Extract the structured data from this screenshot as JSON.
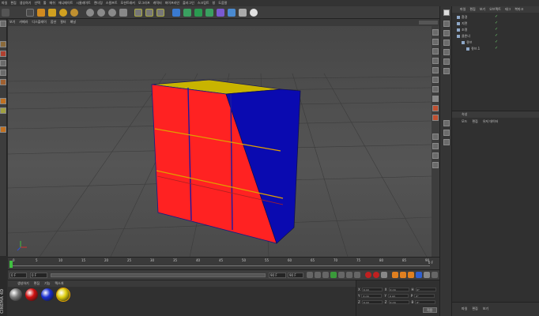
{
  "menubar": {
    "items": [
      "파일",
      "편집",
      "생성하기",
      "선택",
      "툴",
      "메쉬",
      "애니메이트",
      "시뮬레이트",
      "렌더링",
      "스컬프트",
      "모션트래커",
      "모그라프",
      "캐릭터",
      "파이프라인",
      "플러그인",
      "스크립트",
      "창",
      "도움말"
    ]
  },
  "viewport": {
    "menu": [
      "보기",
      "카메라",
      "디스플레이",
      "옵션",
      "필터",
      "패널"
    ]
  },
  "object_manager": {
    "menu": [
      "파일",
      "편집",
      "보기",
      "오브젝트",
      "태그",
      "북마크"
    ],
    "tree": [
      "환경",
      "지면",
      "조명",
      "클론너",
      "큐브",
      "큐브.1"
    ]
  },
  "attributes": {
    "title": "속성",
    "tabs": [
      "모드",
      "편집",
      "유저 데이터"
    ]
  },
  "timeline": {
    "ticks": [
      "0",
      "5",
      "10",
      "15",
      "20",
      "25",
      "30",
      "35",
      "40",
      "45",
      "50",
      "55",
      "60",
      "65",
      "70",
      "75",
      "80",
      "85",
      "90"
    ],
    "current_frame": "0 F",
    "start_frame": "0 F",
    "end_frame": "90 F",
    "max_frame": "90 F",
    "end_marker": "0 F"
  },
  "material_manager": {
    "menu": [
      "생성하기",
      "편집",
      "기능",
      "텍스처"
    ],
    "materials": [
      {
        "color": "#7a7a7a"
      },
      {
        "color": "#d01010"
      },
      {
        "color": "#1a2fd0"
      },
      {
        "color": "#e0d010"
      }
    ]
  },
  "coordinates": {
    "rows": [
      {
        "axis": "X",
        "v1": "0 cm",
        "axis2": "X",
        "v2": "0 cm",
        "axis3": "H",
        "v3": "0°"
      },
      {
        "axis": "Y",
        "v1": "0 cm",
        "axis2": "Y",
        "v2": "0 cm",
        "axis3": "P",
        "v3": "0°"
      },
      {
        "axis": "Z",
        "v1": "0 cm",
        "axis2": "Z",
        "v2": "0 cm",
        "axis3": "B",
        "v3": "0°"
      }
    ],
    "apply_label": "적용"
  },
  "layers_panel": {
    "menu": [
      "파일",
      "편집",
      "보기"
    ]
  },
  "brand": "CINEMA 4D"
}
